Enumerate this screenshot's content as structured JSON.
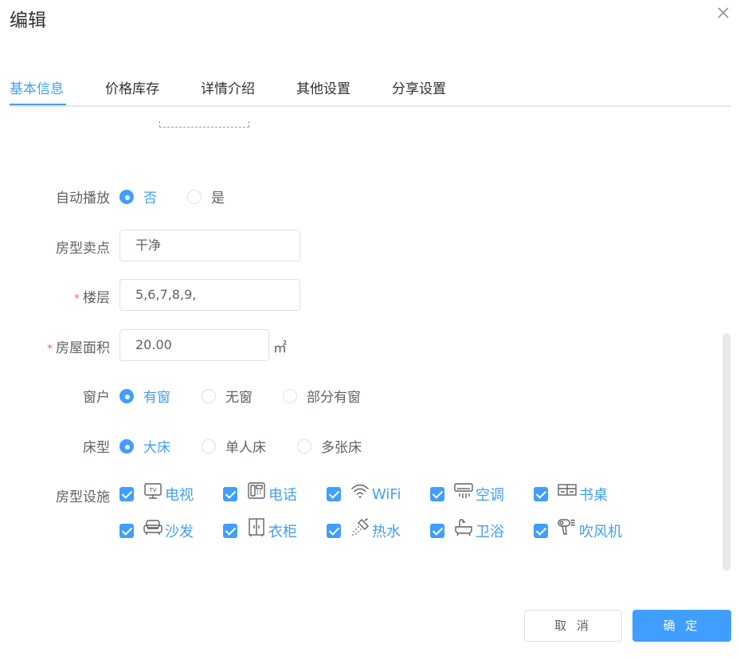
{
  "dialog": {
    "title": "编辑"
  },
  "tabs": [
    {
      "label": "基本信息",
      "active": true
    },
    {
      "label": "价格库存",
      "active": false
    },
    {
      "label": "详情介绍",
      "active": false
    },
    {
      "label": "其他设置",
      "active": false
    },
    {
      "label": "分享设置",
      "active": false
    }
  ],
  "form": {
    "autoplay": {
      "label": "自动播放",
      "options": [
        "否",
        "是"
      ],
      "selected": "否"
    },
    "selling_point": {
      "label": "房型卖点",
      "value": "干净"
    },
    "floor": {
      "label": "楼层",
      "required_mark": "*",
      "value": "5,6,7,8,9,"
    },
    "area": {
      "label": "房屋面积",
      "required_mark": "*",
      "value": "20.00",
      "unit": "㎡"
    },
    "window": {
      "label": "窗户",
      "options": [
        "有窗",
        "无窗",
        "部分有窗"
      ],
      "selected": "有窗"
    },
    "bed": {
      "label": "床型",
      "options": [
        "大床",
        "单人床",
        "多张床"
      ],
      "selected": "大床"
    },
    "facilities": {
      "label": "房型设施",
      "items": [
        {
          "label": "电视",
          "icon": "tv-icon",
          "checked": true
        },
        {
          "label": "电话",
          "icon": "phone-icon",
          "checked": true
        },
        {
          "label": "WiFi",
          "icon": "wifi-icon",
          "checked": true
        },
        {
          "label": "空调",
          "icon": "air-conditioner-icon",
          "checked": true
        },
        {
          "label": "书桌",
          "icon": "desk-icon",
          "checked": true
        },
        {
          "label": "沙发",
          "icon": "sofa-icon",
          "checked": true
        },
        {
          "label": "衣柜",
          "icon": "wardrobe-icon",
          "checked": true
        },
        {
          "label": "热水",
          "icon": "shower-icon",
          "checked": true
        },
        {
          "label": "卫浴",
          "icon": "bathtub-icon",
          "checked": true
        },
        {
          "label": "吹风机",
          "icon": "hair-dryer-icon",
          "checked": true
        }
      ]
    }
  },
  "footer": {
    "cancel_label": "取 消",
    "confirm_label": "确 定"
  },
  "colors": {
    "primary": "#409eff",
    "required": "#f56c6c",
    "text": "#606266",
    "border": "#dcdfe6"
  }
}
